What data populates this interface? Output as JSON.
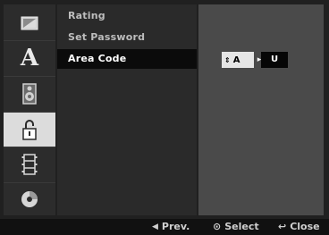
{
  "sidebar": {
    "icons": [
      {
        "name": "general-icon",
        "active": false
      },
      {
        "name": "language-icon",
        "glyph": "A",
        "active": false
      },
      {
        "name": "audio-speaker-icon",
        "active": false
      },
      {
        "name": "lock-icon",
        "active": true
      },
      {
        "name": "film-icon",
        "active": false
      },
      {
        "name": "disc-icon",
        "active": false
      }
    ]
  },
  "menu": {
    "items": [
      {
        "label": "Rating",
        "active": false
      },
      {
        "label": "Set Password",
        "active": false
      },
      {
        "label": "Area Code",
        "active": true
      }
    ]
  },
  "area_code": {
    "first_letter": "A",
    "second_letter": "U",
    "updown_glyph": "⇕",
    "right_arrow_glyph": "▸"
  },
  "bottom_bar": {
    "prev": {
      "glyph": "◀",
      "label": "Prev."
    },
    "select": {
      "glyph": "⊙",
      "label": "Select"
    },
    "close": {
      "glyph": "↩",
      "label": "Close"
    }
  },
  "colors": {
    "sidebar_bg": "#2c2c2c",
    "sidebar_active_bg": "#dcdcdc",
    "menu_bg": "#2a2a2a",
    "menu_active_bg": "#0b0b0b",
    "right_panel_bg": "#4a4a4a",
    "selector_bg": "#e6e6e6",
    "bottom_bar_bg": "#111111"
  }
}
